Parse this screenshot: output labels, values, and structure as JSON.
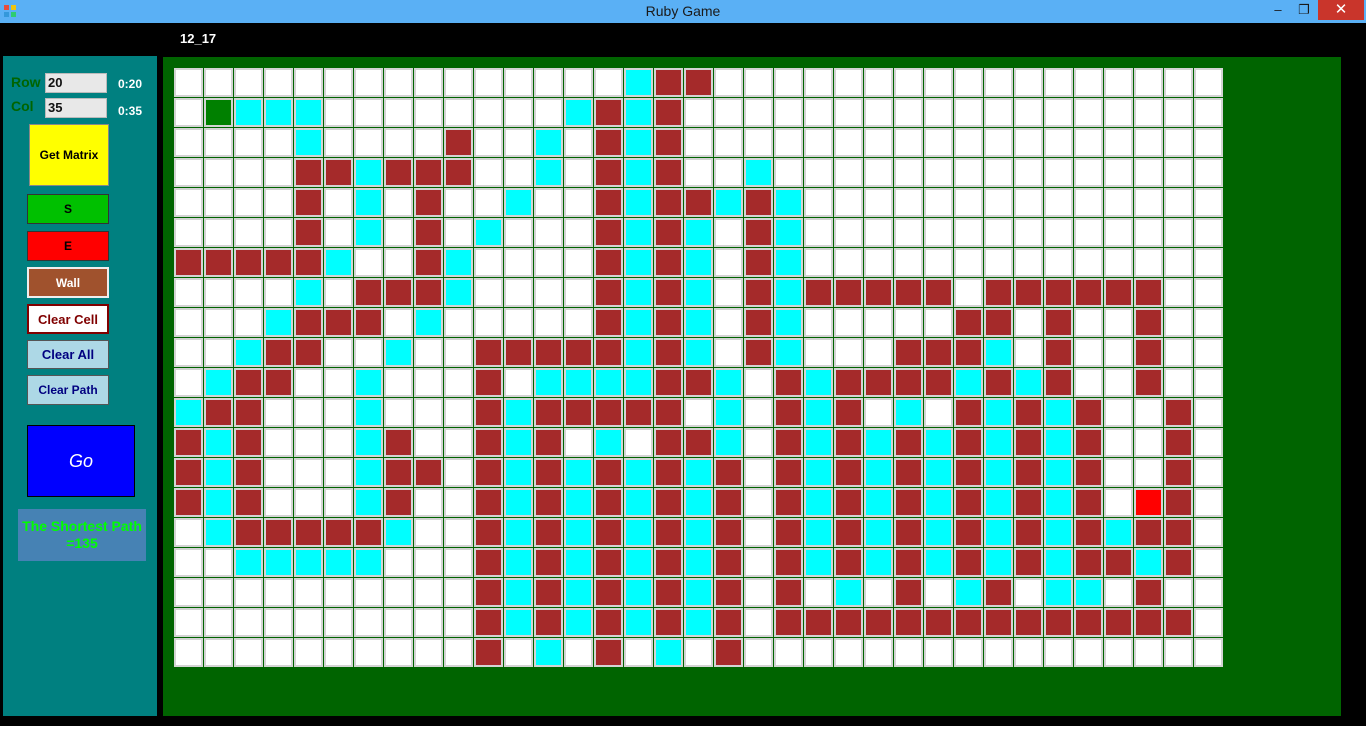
{
  "window": {
    "title": "Ruby Game",
    "minimize_glyph": "–",
    "maximize_glyph": "❐",
    "close_glyph": "✕",
    "app_icon": "app-icon"
  },
  "status": {
    "cell_label": "12_17"
  },
  "controls": {
    "row_label": "Row",
    "row_value": "20",
    "row_timer": "0:20",
    "col_label": "Col",
    "col_value": "35",
    "col_timer": "0:35",
    "get_matrix": "Get Matrix",
    "start": "S",
    "end": "E",
    "wall": "Wall",
    "clear_cell": "Clear Cell",
    "clear_all": "Clear All",
    "clear_path": "Clear Path",
    "go": "Go",
    "result": "The Shortest Path =135"
  },
  "colors": {
    "wall": "#a52a2a",
    "path": "#00ffff",
    "start": "#008000",
    "end": "#ff0000",
    "empty": "#ffffff",
    "board": "#006400",
    "panel": "#008080"
  },
  "grid": {
    "rows": 20,
    "cols": 35,
    "legend": {
      ".": "empty",
      "W": "wall",
      "P": "path",
      "S": "start",
      "E": "end"
    },
    "cells": [
      "...............PWW.................",
      ".SPPP........PWPW..................",
      "....P....W..P.WPW..................",
      "....WWPWWW..P.WPW..P...............",
      "....W.P.W..P..WPWWPWP..............",
      "....W.P.W.P...WPWP.WP..............",
      "WWWWWP..WP....WPWP.WP..............",
      "....P.WWWP....WPWP.WPWWWWW.WWWWWW..",
      "...PWWW.P.....WPWP.WP.....WW.W..W..",
      "..PWW..P..WWWWWPWP.WP...WWWP.W..W..",
      ".PWW..P...W.PPPPWWP.WPWWWWPWPW..W..",
      "PWW...P...WPWWWWW.P.WPW.P.WPWPW..W.",
      "WPW...PW..WPW.P.WWP.WPWPWPWPWPW..W.",
      "WPW...PWW.WPWPWPWPW.WPWPWPWPWPW..W.",
      "WPW...PW..WPWPWPWPW.WPWPWPWPWPW.EW.",
      ".PWWWWWP..WPWPWPWPW.WPWPWPWPWPWPWW.",
      "..PPPPP...WPWPWPWPW.WPWPWPWPWPWWPW.",
      "..........WPWPWPWPW.W.P.W.PW.PP.W..",
      "..........WPWPWPWPW.WWWWWWWWWWWWWW.",
      "..........W.P.W.P.W................"
    ]
  }
}
